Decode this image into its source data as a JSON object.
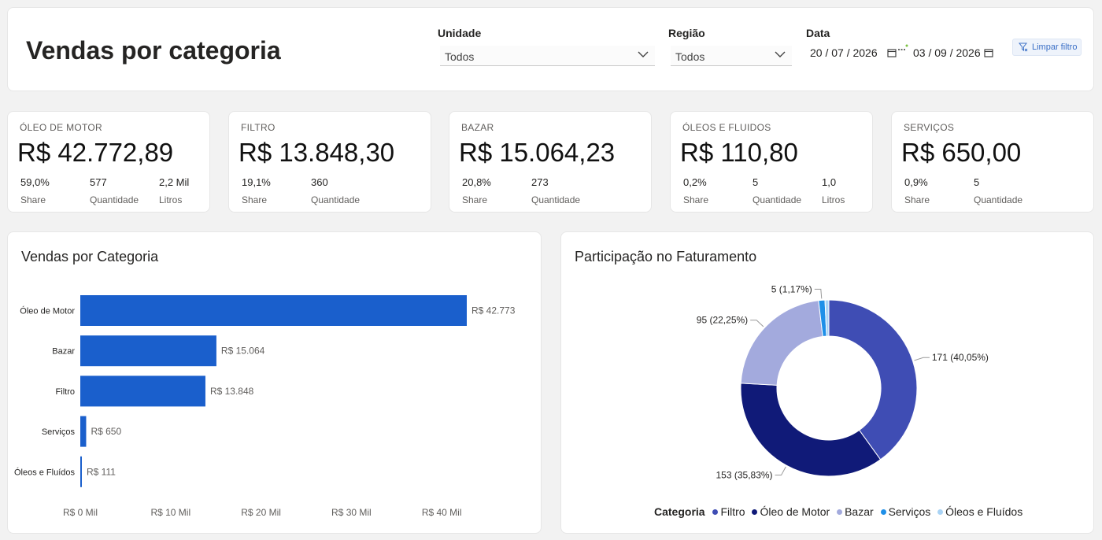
{
  "header": {
    "title": "Vendas por categoria",
    "filters": {
      "unidade": {
        "label": "Unidade",
        "value": "Todos"
      },
      "regiao": {
        "label": "Região",
        "value": "Todos"
      },
      "data": {
        "label": "Data",
        "start": "20 / 07 / 2026",
        "end": "03 / 09 / 2026"
      }
    },
    "clear_filter_label": "Limpar filtro"
  },
  "kpis": [
    {
      "title": "ÓLEO DE MOTOR",
      "value": "R$ 42.772,89",
      "stats": [
        {
          "v": "59,0%",
          "l": "Share"
        },
        {
          "v": "577",
          "l": "Quantidade"
        },
        {
          "v": "2,2 Mil",
          "l": "Litros"
        }
      ]
    },
    {
      "title": "FILTRO",
      "value": "R$ 13.848,30",
      "stats": [
        {
          "v": "19,1%",
          "l": "Share"
        },
        {
          "v": "360",
          "l": "Quantidade"
        }
      ]
    },
    {
      "title": "BAZAR",
      "value": "R$ 15.064,23",
      "stats": [
        {
          "v": "20,8%",
          "l": "Share"
        },
        {
          "v": "273",
          "l": "Quantidade"
        }
      ]
    },
    {
      "title": "ÓLEOS E FLUIDOS",
      "value": "R$ 110,80",
      "stats": [
        {
          "v": "0,2%",
          "l": "Share"
        },
        {
          "v": "5",
          "l": "Quantidade"
        },
        {
          "v": "1,0",
          "l": "Litros"
        }
      ]
    },
    {
      "title": "SERVIÇOS",
      "value": "R$ 650,00",
      "stats": [
        {
          "v": "0,9%",
          "l": "Share"
        },
        {
          "v": "5",
          "l": "Quantidade"
        }
      ]
    }
  ],
  "colors": {
    "bar": "#1a5fcc",
    "filtro": "#3f4db4",
    "oleo_de_motor": "#101a78",
    "bazar": "#a3aadd",
    "servicos": "#1e8fe8",
    "oleos_e_fluidos": "#a9d3f5"
  },
  "chart_data": [
    {
      "type": "bar",
      "orientation": "horizontal",
      "title": "Vendas por Categoria",
      "categories": [
        "Óleo de Motor",
        "Bazar",
        "Filtro",
        "Serviços",
        "Óleos e Fluídos"
      ],
      "values": [
        42773,
        15064,
        13848,
        650,
        111
      ],
      "data_labels": [
        "R$ 42.773",
        "R$ 15.064",
        "R$ 13.848",
        "R$ 650",
        "R$ 111"
      ],
      "x_ticks": [
        0,
        10000,
        20000,
        30000,
        40000
      ],
      "x_tick_labels": [
        "R$ 0 Mil",
        "R$ 10 Mil",
        "R$ 20 Mil",
        "R$ 30 Mil",
        "R$ 40 Mil"
      ],
      "xlim": [
        0,
        48000
      ],
      "grid": false
    },
    {
      "type": "pie",
      "donut": true,
      "title": "Participação no Faturamento",
      "legend_title": "Categoria",
      "legend_position": "bottom",
      "legend": [
        "Filtro",
        "Óleo de Motor",
        "Bazar",
        "Serviços",
        "Óleos e Fluídos"
      ],
      "slices": [
        {
          "name": "Filtro",
          "value": 171,
          "label": "171 (40,05%)",
          "color": "#3f4db4"
        },
        {
          "name": "Óleo de Motor",
          "value": 153,
          "label": "153 (35,83%)",
          "color": "#101a78"
        },
        {
          "name": "Bazar",
          "value": 95,
          "label": "95 (22,25%)",
          "color": "#a3aadd"
        },
        {
          "name": "Serviços",
          "value": 5,
          "label": "5 (1,17%)",
          "color": "#1e8fe8"
        },
        {
          "name": "Óleos e Fluídos",
          "value": 3,
          "label": "",
          "color": "#a9d3f5"
        }
      ]
    }
  ]
}
